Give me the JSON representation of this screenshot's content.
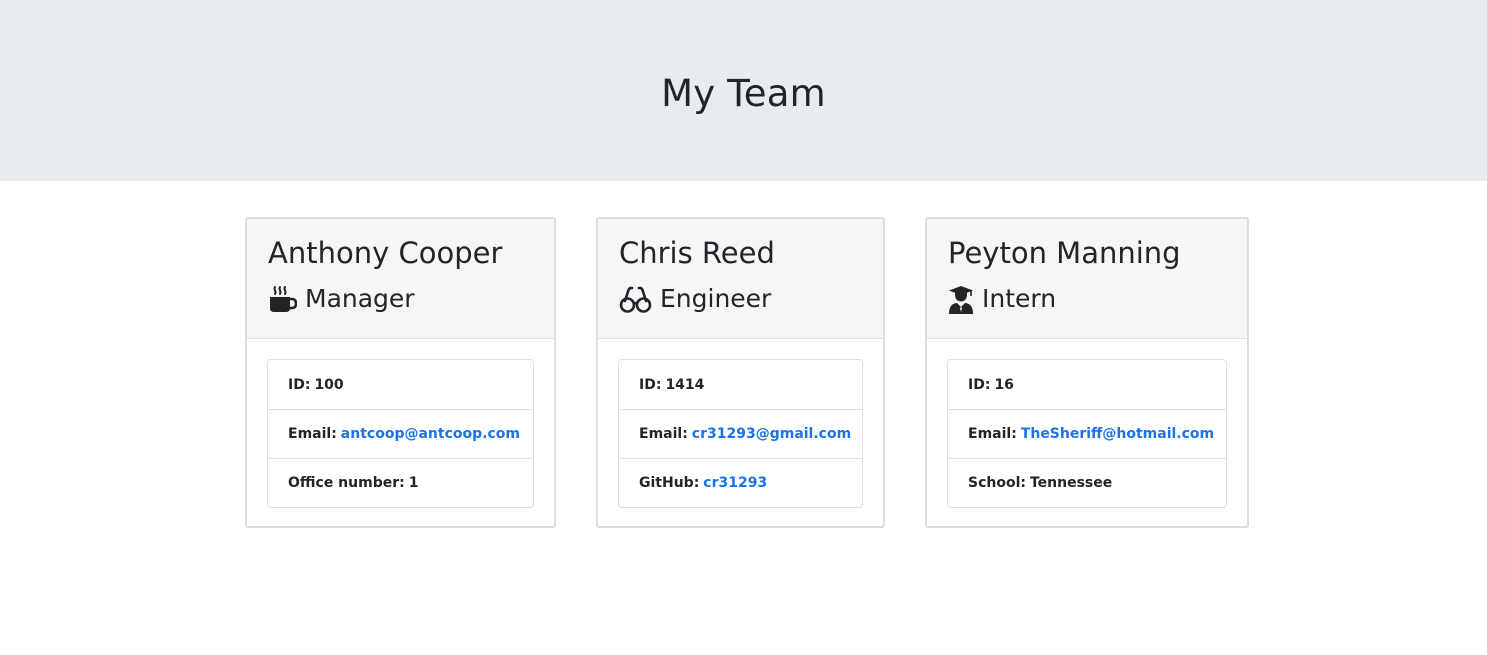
{
  "header": {
    "title": "My Team"
  },
  "colors": {
    "jumbotron_bg": "#e9ecef",
    "link": "#1a73e8",
    "card_header_bg": "#f6f6f6"
  },
  "team": [
    {
      "name": "Anthony Cooper",
      "role": "Manager",
      "role_icon": "mug-hot-icon",
      "id_label": "ID:",
      "id_value": "100",
      "email_label": "Email:",
      "email": "antcoop@antcoop.com",
      "extra_label": "Office number:",
      "extra_value": "1"
    },
    {
      "name": "Chris Reed",
      "role": "Engineer",
      "role_icon": "glasses-icon",
      "id_label": "ID:",
      "id_value": "1414",
      "email_label": "Email:",
      "email": "cr31293@gmail.com",
      "extra_label": "GitHub:",
      "extra_value": "cr31293"
    },
    {
      "name": "Peyton Manning",
      "role": "Intern",
      "role_icon": "user-graduate-icon",
      "id_label": "ID:",
      "id_value": "16",
      "email_label": "Email:",
      "email": "TheSheriff@hotmail.com",
      "extra_label": "School:",
      "extra_value": "Tennessee"
    }
  ]
}
